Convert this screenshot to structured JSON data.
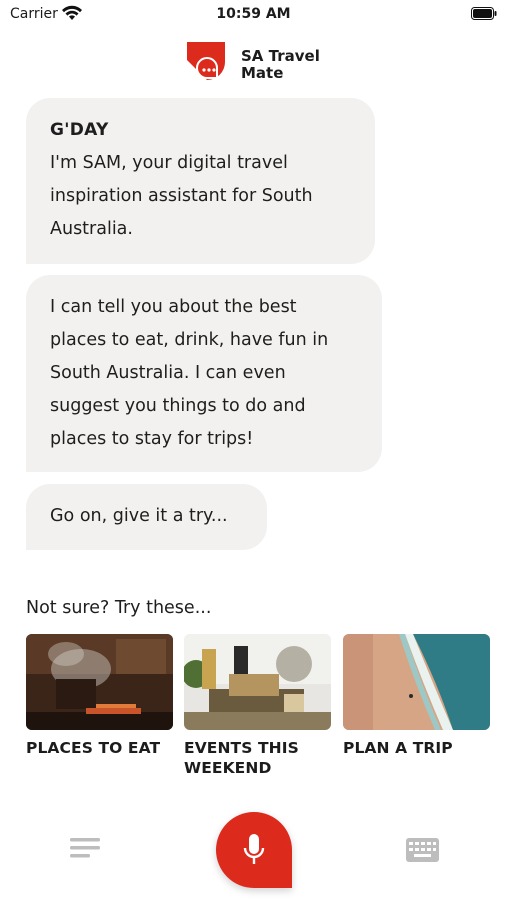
{
  "status": {
    "carrier": "Carrier",
    "time": "10:59 AM"
  },
  "app": {
    "title": "SA Travel Mate"
  },
  "colors": {
    "brand_red": "#dc2a1d",
    "bubble_bg": "#f3f1ef",
    "icon_gray": "#bdbdbd"
  },
  "messages": [
    {
      "greeting": "G'DAY",
      "text": "I'm SAM, your digital travel inspiration assistant for South Australia."
    },
    {
      "text": "I can tell you about the best places to eat, drink, have fun in South Australia. I can even suggest you things to do and places to stay for trips!"
    },
    {
      "text": "Go on, give it a try..."
    }
  ],
  "suggestions": {
    "heading": "Not sure? Try these...",
    "cards": [
      {
        "label": "PLACES TO EAT"
      },
      {
        "label": "EVENTS THIS WEEKEND"
      },
      {
        "label": "PLAN A TRIP"
      }
    ]
  },
  "icons": {
    "menu": "menu-lines-icon",
    "mic": "microphone-icon",
    "keyboard": "keyboard-icon"
  }
}
